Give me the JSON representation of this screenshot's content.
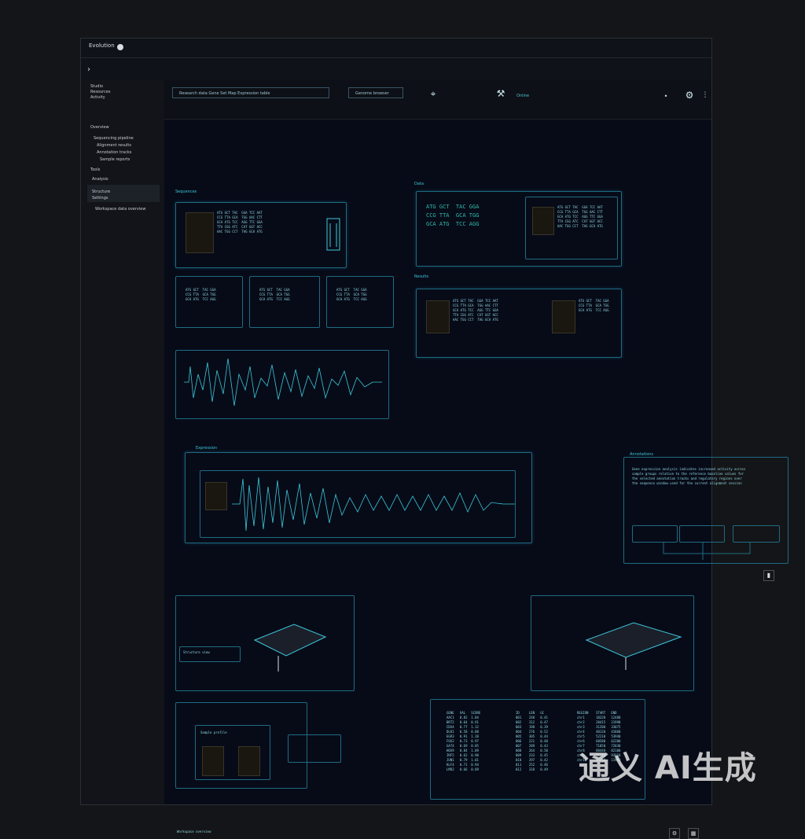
{
  "window": {
    "title": "Evolution"
  },
  "sidebar": {
    "header": "Studio\nResources\nActivity",
    "section_main": "Overview",
    "groups": [
      "Sequencing pipeline",
      "Alignment results",
      "Annotation tracks",
      "Sample reports"
    ],
    "section_secondary": "Tools",
    "items": [
      "Analysis",
      "Structure",
      "Settings"
    ],
    "footer": "Workspace data overview"
  },
  "toolbar": {
    "search_value": "Research data   Gene   Set   Map   Expression table",
    "filter_value": "Genome browser",
    "status": "Online"
  },
  "panels": {
    "p1_title": "Sequences",
    "p2_title": "Data",
    "p3_title": "Results",
    "p4_title": "Expression",
    "p5_title": "Annotations"
  },
  "text_blocks": {
    "p1": "ATG GCT TAC  GGA TCC AAT\nCCG TTA GCA  TGG AAC CTT\nGCA ATG TCC  AGG TTC GGA\nTTA CGG ATC  CAT GGT ACC\nAAC TGG CCT  TAG GCA ATG",
    "p2": "ATG GCT  TAC GGA\nCCG TTA  GCA TGG\nGCA ATG  TCC AGG",
    "p5": "Gene expression analysis indicates increased activity across\nsample groups relative to the reference baseline values for\nthe selected annotation tracks and regulatory regions over\nthe sequence window used for the current alignment session",
    "table_left": "GENE   VAL   SCORE\nAAC1   0.82  1.04\nBRT2   0.64  0.91\nCDX4   0.77  1.12\nDLK1   0.58  0.88\nEGR3   0.91  1.20\nFOX2   0.73  0.97\nGAT4   0.69  0.85\nHOX9   0.84  1.09\nIRF5   0.62  0.90\nJUN1   0.79  1.01\nKLF4   0.71  0.94\nLMO2   0.66  0.89",
    "table_mid": "ID     LEN   GC\n001    248   0.41\n002    312   0.47\n003    198   0.39\n004    276   0.52\n005    305   0.44\n006    221   0.48\n007    289   0.43\n008    264   0.50\n009    233   0.45\n010    297   0.42\n011    252   0.46\n012    318   0.49",
    "table_right": "REGION    START   END\nchr1      10320   12480\nchr2      20415   21990\nchr3      31280   33075\nchr4      40120   41860\nchr5      52210   53940\nchr6      60580   62200\nchr7      71050   72830\nchr8      80440   82100\nchr9      91370   93010\nchr10     10250   11980",
    "node_label": "Structure view",
    "profile": "Sample profile"
  },
  "bottom": {
    "left": "Workspace overview",
    "icons": [
      "gear-icon",
      "grid-icon"
    ]
  },
  "watermark": "通义 AI生成",
  "colors": {
    "accent": "#3cc7d9",
    "panel_border": "#1e6b82",
    "canvas": "#070b18"
  }
}
